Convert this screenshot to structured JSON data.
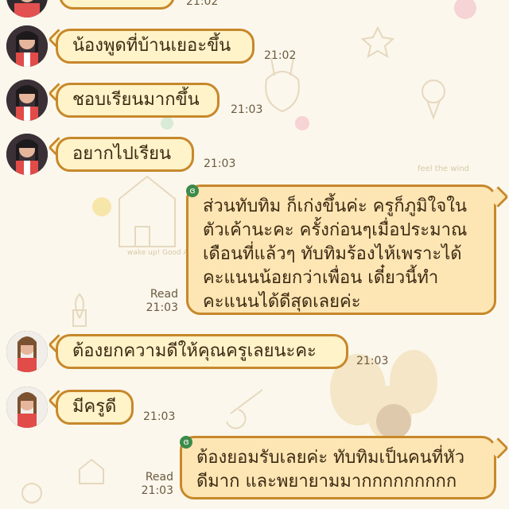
{
  "messages": [
    {
      "id": "m0",
      "text": "",
      "time": "21:02"
    },
    {
      "id": "m1",
      "text": "น้องพูดที่บ้านเยอะขึ้น",
      "time": "21:02"
    },
    {
      "id": "m2",
      "text": "ชอบเรียนมากขึ้น",
      "time": "21:03"
    },
    {
      "id": "m3",
      "text": "อยากไปเรียน",
      "time": "21:03"
    },
    {
      "id": "m4",
      "text": "ส่วนทับทิม ก็เก่งขึ้นค่ะ ครูก็ภูมิใจใน\nตัวเค้านะคะ ครั้งก่อนๆเมื่อประมาณ\nเดือนที่แล้วๆ ทับทิมร้องไห้เพราะได้\nคะแนนน้อยกว่าเพื่อน เดี๋ยวนี้ทำ\nคะแนนได้ดีสุดเลยค่ะ",
      "read": "Read",
      "time": "21:03"
    },
    {
      "id": "m5",
      "text": "ต้องยกความดีให้คุณครูเลยนะคะ",
      "time": "21:03"
    },
    {
      "id": "m6",
      "text": "มีครูดี",
      "time": "21:03"
    },
    {
      "id": "m7",
      "text": "ต้องยอมรับเลยค่ะ ทับทิมเป็นคนที่หัว\nดีมาก และพยายามมากกกกกกกกก",
      "read": "Read",
      "time": "21:03"
    }
  ],
  "wallpaper_text": {
    "w1": "feel the wind",
    "w2": "wake up! Good AM"
  },
  "colors": {
    "bubble_border": "#c7882b",
    "bubble_in": "#fff3c9",
    "bubble_out": "#fde6b4",
    "wallpaper": "#fbf7ec"
  }
}
